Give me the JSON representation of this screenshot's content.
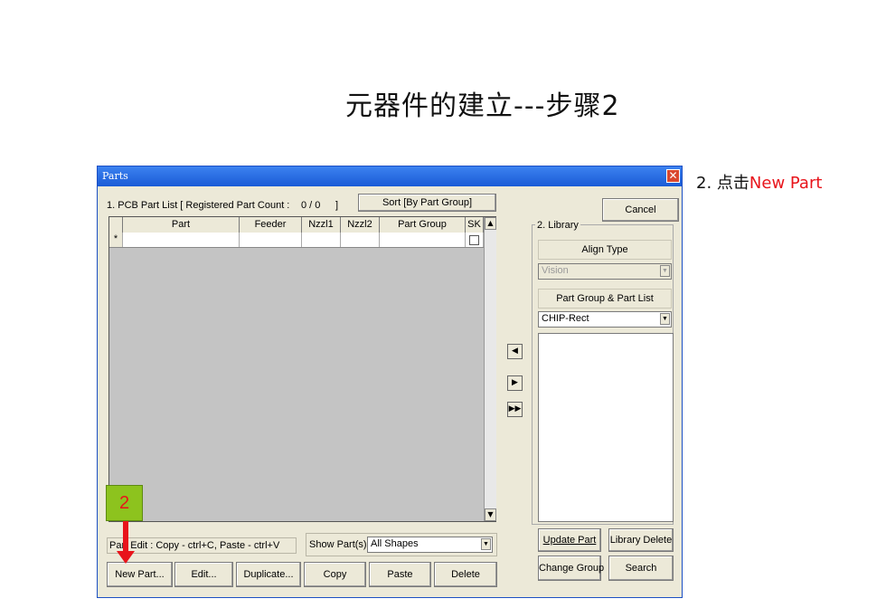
{
  "slide": {
    "title": "元器件的建立---步骤2",
    "note_prefix": "2. 点击",
    "note_highlight": "New  Part",
    "badge": "2"
  },
  "window": {
    "title": "Parts",
    "close_glyph": "✕",
    "part_list_label": "1. PCB Part List  [ Registered Part Count :",
    "count_value": "0 / 0",
    "count_close": "]",
    "sort_button": "Sort [By Part Group]",
    "cancel_button": "Cancel",
    "columns": [
      "",
      "Part",
      "Feeder",
      "Nzzl1",
      "Nzzl2",
      "Part Group",
      "SK"
    ],
    "new_row_marker": "*",
    "edit_hint": "Part Edit : Copy - ctrl+C,  Paste - ctrl+V",
    "show_parts_label": "Show Part(s)",
    "show_parts_value": "All Shapes",
    "buttons": {
      "new_part": "New Part...",
      "edit": "Edit...",
      "duplicate": "Duplicate...",
      "copy": "Copy",
      "paste": "Paste",
      "delete": "Delete"
    },
    "library": {
      "group_label": "2. Library",
      "align_type_label": "Align Type",
      "align_type_value": "Vision",
      "part_group_label": "Part Group & Part List",
      "part_group_value": "CHIP-Rect",
      "update_part": "Update Part",
      "library_delete": "Library Delete",
      "change_group": "Change Group",
      "search": "Search"
    },
    "move_buttons": [
      "◀",
      "▶",
      "▶▶"
    ]
  },
  "colors": {
    "accent_red": "#e8141b",
    "badge_green": "#8dc31e",
    "titlebar_blue": "#1a5bd6"
  },
  "icons": [
    "close-icon",
    "scroll-up-icon",
    "scroll-down-icon",
    "dropdown-arrow-icon",
    "move-left-icon",
    "move-right-icon",
    "move-all-right-icon",
    "red-arrow-down-icon"
  ]
}
